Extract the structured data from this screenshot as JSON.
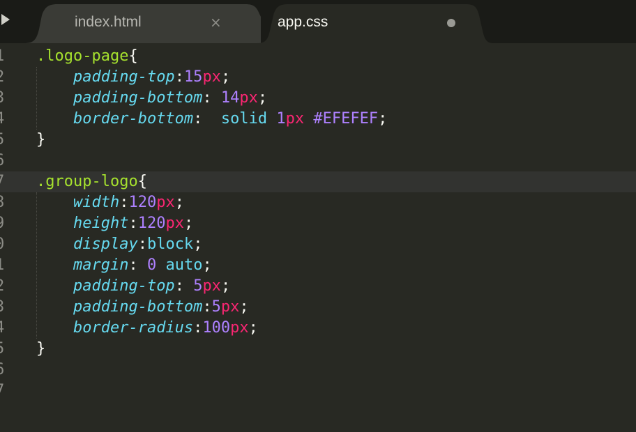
{
  "tabs": [
    {
      "label": "index.html",
      "state": "inactive",
      "close_glyph": "×"
    },
    {
      "label": "app.css",
      "state": "active",
      "modified": true
    }
  ],
  "colors": {
    "background": "#282923",
    "tabbar": "#1a1b17",
    "active_tab": "#282923",
    "inactive_tab": "#3a3b36",
    "selector": "#a6e22e",
    "property": "#66d9ef",
    "number": "#ae81ff",
    "unit": "#f92672",
    "punctuation": "#f8f8f2"
  },
  "editor": {
    "current_line": 7,
    "line_numbers": [
      "1",
      "2",
      "3",
      "4",
      "5",
      "6",
      "7",
      "8",
      "9",
      "0",
      "1",
      "2",
      "3",
      "4",
      "5",
      "6",
      "7"
    ],
    "lines": [
      [
        {
          "t": ".logo-page",
          "c": "sel"
        },
        {
          "t": "{",
          "c": "pun"
        }
      ],
      [
        {
          "t": "    "
        },
        {
          "t": "padding-top",
          "c": "prop"
        },
        {
          "t": ":",
          "c": "pun"
        },
        {
          "t": "15",
          "c": "num"
        },
        {
          "t": "px",
          "c": "unit"
        },
        {
          "t": ";",
          "c": "pun"
        }
      ],
      [
        {
          "t": "    "
        },
        {
          "t": "padding-bottom",
          "c": "prop"
        },
        {
          "t": ": ",
          "c": "pun"
        },
        {
          "t": "14",
          "c": "num"
        },
        {
          "t": "px",
          "c": "unit"
        },
        {
          "t": ";",
          "c": "pun"
        }
      ],
      [
        {
          "t": "    "
        },
        {
          "t": "border-bottom",
          "c": "prop"
        },
        {
          "t": ":  ",
          "c": "pun"
        },
        {
          "t": "solid",
          "c": "kw"
        },
        {
          "t": " "
        },
        {
          "t": "1",
          "c": "num"
        },
        {
          "t": "px",
          "c": "unit"
        },
        {
          "t": " "
        },
        {
          "t": "#EFEFEF",
          "c": "num"
        },
        {
          "t": ";",
          "c": "pun"
        }
      ],
      [
        {
          "t": "}",
          "c": "pun"
        }
      ],
      [],
      [
        {
          "t": ".group-logo",
          "c": "sel"
        },
        {
          "t": "{",
          "c": "pun"
        }
      ],
      [
        {
          "t": "    "
        },
        {
          "t": "width",
          "c": "prop"
        },
        {
          "t": ":",
          "c": "pun"
        },
        {
          "t": "120",
          "c": "num"
        },
        {
          "t": "px",
          "c": "unit"
        },
        {
          "t": ";",
          "c": "pun"
        }
      ],
      [
        {
          "t": "    "
        },
        {
          "t": "height",
          "c": "prop"
        },
        {
          "t": ":",
          "c": "pun"
        },
        {
          "t": "120",
          "c": "num"
        },
        {
          "t": "px",
          "c": "unit"
        },
        {
          "t": ";",
          "c": "pun"
        }
      ],
      [
        {
          "t": "    "
        },
        {
          "t": "display",
          "c": "prop"
        },
        {
          "t": ":",
          "c": "pun"
        },
        {
          "t": "block",
          "c": "kw"
        },
        {
          "t": ";",
          "c": "pun"
        }
      ],
      [
        {
          "t": "    "
        },
        {
          "t": "margin",
          "c": "prop"
        },
        {
          "t": ": ",
          "c": "pun"
        },
        {
          "t": "0",
          "c": "num"
        },
        {
          "t": " "
        },
        {
          "t": "auto",
          "c": "kw"
        },
        {
          "t": ";",
          "c": "pun"
        }
      ],
      [
        {
          "t": "    "
        },
        {
          "t": "padding-top",
          "c": "prop"
        },
        {
          "t": ": ",
          "c": "pun"
        },
        {
          "t": "5",
          "c": "num"
        },
        {
          "t": "px",
          "c": "unit"
        },
        {
          "t": ";",
          "c": "pun"
        }
      ],
      [
        {
          "t": "    "
        },
        {
          "t": "padding-bottom",
          "c": "prop"
        },
        {
          "t": ":",
          "c": "pun"
        },
        {
          "t": "5",
          "c": "num"
        },
        {
          "t": "px",
          "c": "unit"
        },
        {
          "t": ";",
          "c": "pun"
        }
      ],
      [
        {
          "t": "    "
        },
        {
          "t": "border-radius",
          "c": "prop"
        },
        {
          "t": ":",
          "c": "pun"
        },
        {
          "t": "100",
          "c": "num"
        },
        {
          "t": "px",
          "c": "unit"
        },
        {
          "t": ";",
          "c": "pun"
        }
      ],
      [
        {
          "t": "}",
          "c": "pun"
        }
      ],
      [],
      []
    ]
  }
}
